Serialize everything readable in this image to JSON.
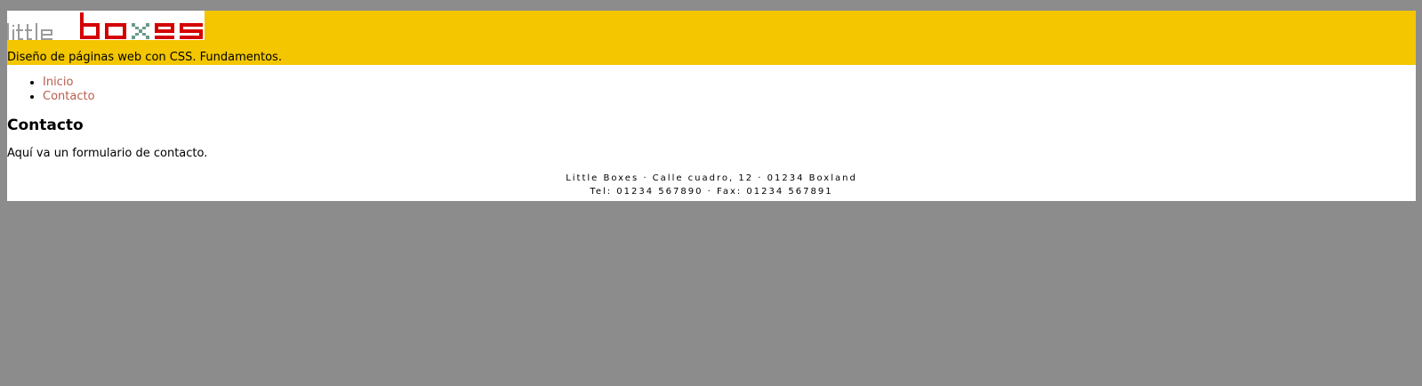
{
  "header": {
    "logo": {
      "text_part1": "little",
      "text_part2": "boxes",
      "colors": {
        "little": "#9a9a9a",
        "boxes": "#d40000",
        "x_accent": "#6a9a88"
      }
    },
    "tagline": "Diseño de páginas web con CSS. Fundamentos."
  },
  "nav": {
    "items": [
      {
        "label": "Inicio"
      },
      {
        "label": "Contacto"
      }
    ]
  },
  "main": {
    "title": "Contacto",
    "text": "Aquí va un formulario de contacto."
  },
  "footer": {
    "line1": "Little Boxes · Calle cuadro, 12 · 01234 Boxland",
    "line2": "Tel: 01234 567890 · Fax: 01234 567891"
  },
  "colors": {
    "background": "#8c8c8c",
    "header": "#f3c600",
    "page": "#ffffff",
    "link": "#b85c4c"
  }
}
